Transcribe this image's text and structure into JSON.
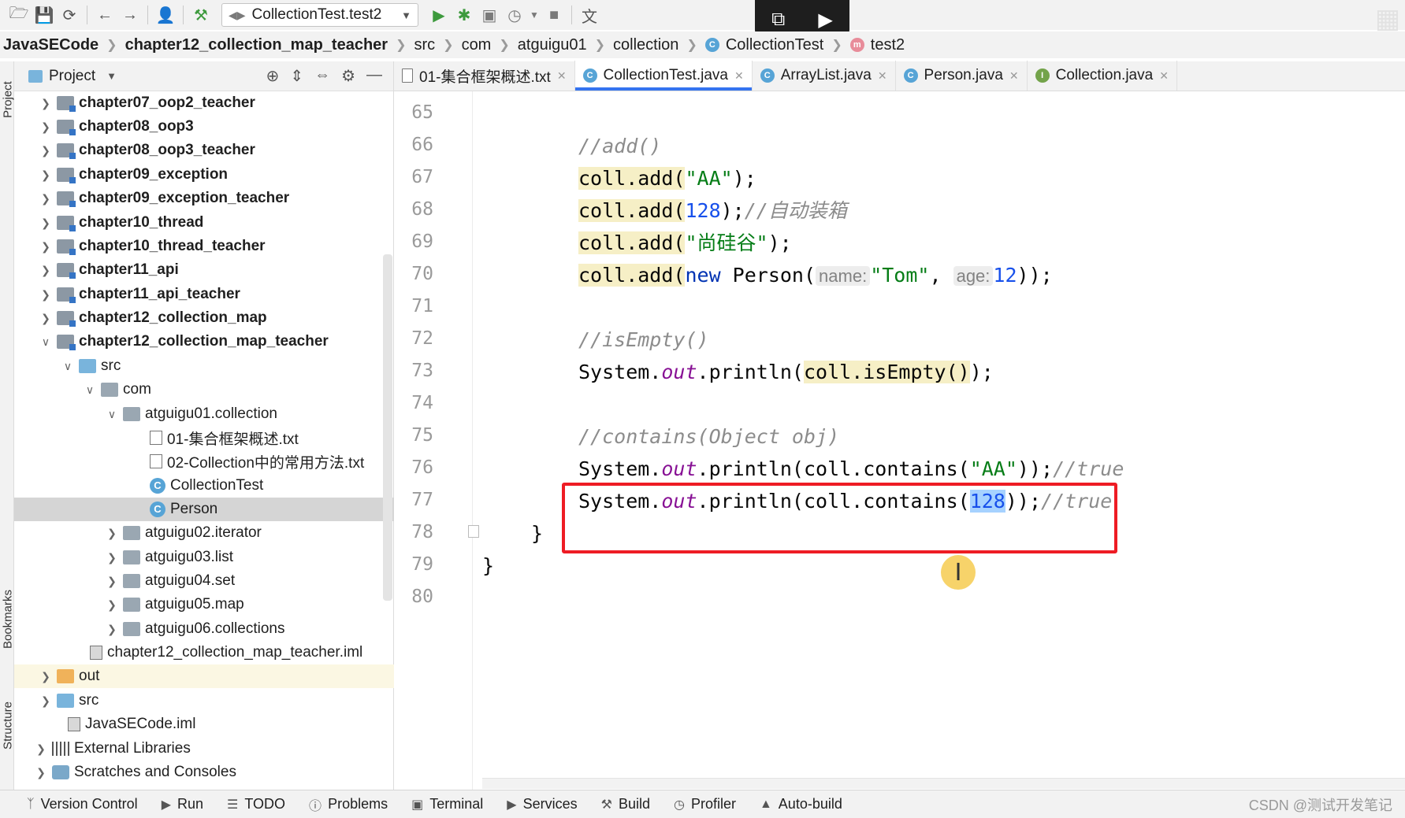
{
  "toolbar": {
    "run_config": "CollectionTest.test2"
  },
  "breadcrumb": [
    "JavaSECode",
    "chapter12_collection_map_teacher",
    "src",
    "com",
    "atguigu01",
    "collection",
    "CollectionTest",
    "test2"
  ],
  "side_strip": {
    "project": "Project",
    "bookmarks": "Bookmarks",
    "structure": "Structure"
  },
  "project_panel": {
    "title": "Project"
  },
  "tree": [
    {
      "label": "chapter07_oop2_teacher",
      "bold": true,
      "expanded": false
    },
    {
      "label": "chapter08_oop3",
      "bold": true,
      "expanded": false
    },
    {
      "label": "chapter08_oop3_teacher",
      "bold": true,
      "expanded": false
    },
    {
      "label": "chapter09_exception",
      "bold": true,
      "expanded": false
    },
    {
      "label": "chapter09_exception_teacher",
      "bold": true,
      "expanded": false
    },
    {
      "label": "chapter10_thread",
      "bold": true,
      "expanded": false
    },
    {
      "label": "chapter10_thread_teacher",
      "bold": true,
      "expanded": false
    },
    {
      "label": "chapter11_api",
      "bold": true,
      "expanded": false
    },
    {
      "label": "chapter11_api_teacher",
      "bold": true,
      "expanded": false
    },
    {
      "label": "chapter12_collection_map",
      "bold": true,
      "expanded": false
    },
    {
      "label": "chapter12_collection_map_teacher",
      "bold": true,
      "expanded": true
    },
    {
      "label": "src",
      "bold": false,
      "expanded": true
    },
    {
      "label": "com",
      "bold": false,
      "expanded": true
    },
    {
      "label": "atguigu01.collection",
      "bold": false,
      "expanded": true
    },
    {
      "label": "01-集合框架概述.txt",
      "bold": false
    },
    {
      "label": "02-Collection中的常用方法.txt",
      "bold": false
    },
    {
      "label": "CollectionTest",
      "bold": false
    },
    {
      "label": "Person",
      "bold": false,
      "selected": true
    },
    {
      "label": "atguigu02.iterator",
      "bold": false,
      "expanded": false
    },
    {
      "label": "atguigu03.list",
      "bold": false,
      "expanded": false
    },
    {
      "label": "atguigu04.set",
      "bold": false,
      "expanded": false
    },
    {
      "label": "atguigu05.map",
      "bold": false,
      "expanded": false
    },
    {
      "label": "atguigu06.collections",
      "bold": false,
      "expanded": false
    },
    {
      "label": "chapter12_collection_map_teacher.iml",
      "bold": false
    },
    {
      "label": "out",
      "bold": false,
      "expanded": false
    },
    {
      "label": "src",
      "bold": false,
      "expanded": false
    },
    {
      "label": "JavaSECode.iml",
      "bold": false
    },
    {
      "label": "External Libraries",
      "bold": false,
      "expanded": false
    },
    {
      "label": "Scratches and Consoles",
      "bold": false,
      "expanded": false
    }
  ],
  "tabs": [
    {
      "label": "01-集合框架概述.txt",
      "active": false
    },
    {
      "label": "CollectionTest.java",
      "active": true
    },
    {
      "label": "ArrayList.java",
      "active": false
    },
    {
      "label": "Person.java",
      "active": false
    },
    {
      "label": "Collection.java",
      "active": false
    }
  ],
  "editor": {
    "line_numbers": [
      "65",
      "66",
      "67",
      "68",
      "69",
      "70",
      "71",
      "72",
      "73",
      "74",
      "75",
      "76",
      "77",
      "78",
      "79",
      "80"
    ],
    "code": {
      "l66": "//add()",
      "l67_a": "coll.add(",
      "l67_s": "\"AA\"",
      "l67_b": ");",
      "l68_a": "coll.add(",
      "l68_n": "128",
      "l68_b": ");",
      "l68_c": "//自动装箱",
      "l69_a": "coll.add(",
      "l69_s": "\"尚硅谷\"",
      "l69_b": ");",
      "l70_a": "coll.add(",
      "l70_kw": "new",
      "l70_b": " Person(",
      "l70_h1": "name:",
      "l70_s": "\"Tom\"",
      "l70_c": ", ",
      "l70_h2": "age:",
      "l70_n": "12",
      "l70_d": "));",
      "l72": "//isEmpty()",
      "l73_a": "System.",
      "l73_f": "out",
      "l73_b": ".println(",
      "l73_w": "coll.isEmpty()",
      "l73_c": ");",
      "l75": "//contains(Object obj)",
      "l76_a": "System.",
      "l76_f": "out",
      "l76_b": ".println(coll.contains(",
      "l76_s": "\"AA\"",
      "l76_c": "));",
      "l76_cm": "//true",
      "l77_a": "System.",
      "l77_f": "out",
      "l77_b": ".println(coll.contains(",
      "l77_n": "128",
      "l77_c": "));",
      "l77_cm": "//true",
      "l78": "}",
      "l79": "}"
    }
  },
  "statusbar": [
    "Version Control",
    "Run",
    "TODO",
    "Problems",
    "Terminal",
    "Services",
    "Build",
    "Profiler",
    "Auto-build"
  ],
  "watermark": "CSDN @测试开发笔记",
  "colors": {
    "accent": "#3574f0",
    "highlight_box": "#ee1c24",
    "comment": "#8c8c8c",
    "string": "#067d17",
    "number": "#1750eb"
  }
}
